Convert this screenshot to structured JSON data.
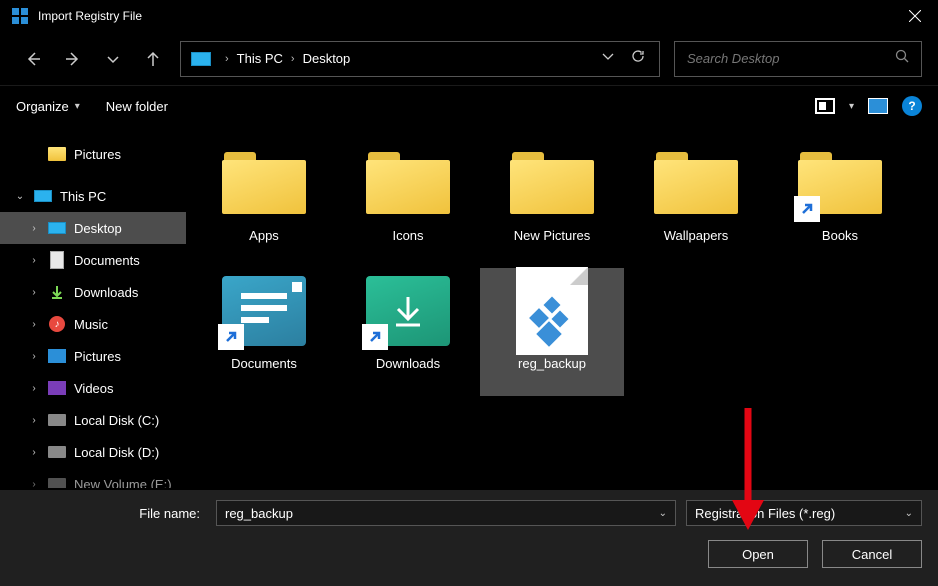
{
  "window": {
    "title": "Import Registry File"
  },
  "addressbar": {
    "crumbs": [
      "This PC",
      "Desktop"
    ]
  },
  "search": {
    "placeholder": "Search Desktop"
  },
  "cmdbar": {
    "organize": "Organize",
    "newfolder": "New folder",
    "help": "?"
  },
  "tree": {
    "pictures": "Pictures",
    "thispc": "This PC",
    "desktop": "Desktop",
    "documents": "Documents",
    "downloads": "Downloads",
    "music": "Music",
    "pictures2": "Pictures",
    "videos": "Videos",
    "localc": "Local Disk (C:)",
    "locald": "Local Disk (D:)",
    "newvol": "New Volume (E:)"
  },
  "items": {
    "apps": "Apps",
    "icons": "Icons",
    "newpics": "New Pictures",
    "wallpapers": "Wallpapers",
    "books": "Books",
    "documents": "Documents",
    "downloads": "Downloads",
    "regbackup": "reg_backup"
  },
  "footer": {
    "filename_label": "File name:",
    "filename_value": "reg_backup",
    "filetype": "Registration Files (*.reg)",
    "open": "Open",
    "cancel": "Cancel"
  }
}
